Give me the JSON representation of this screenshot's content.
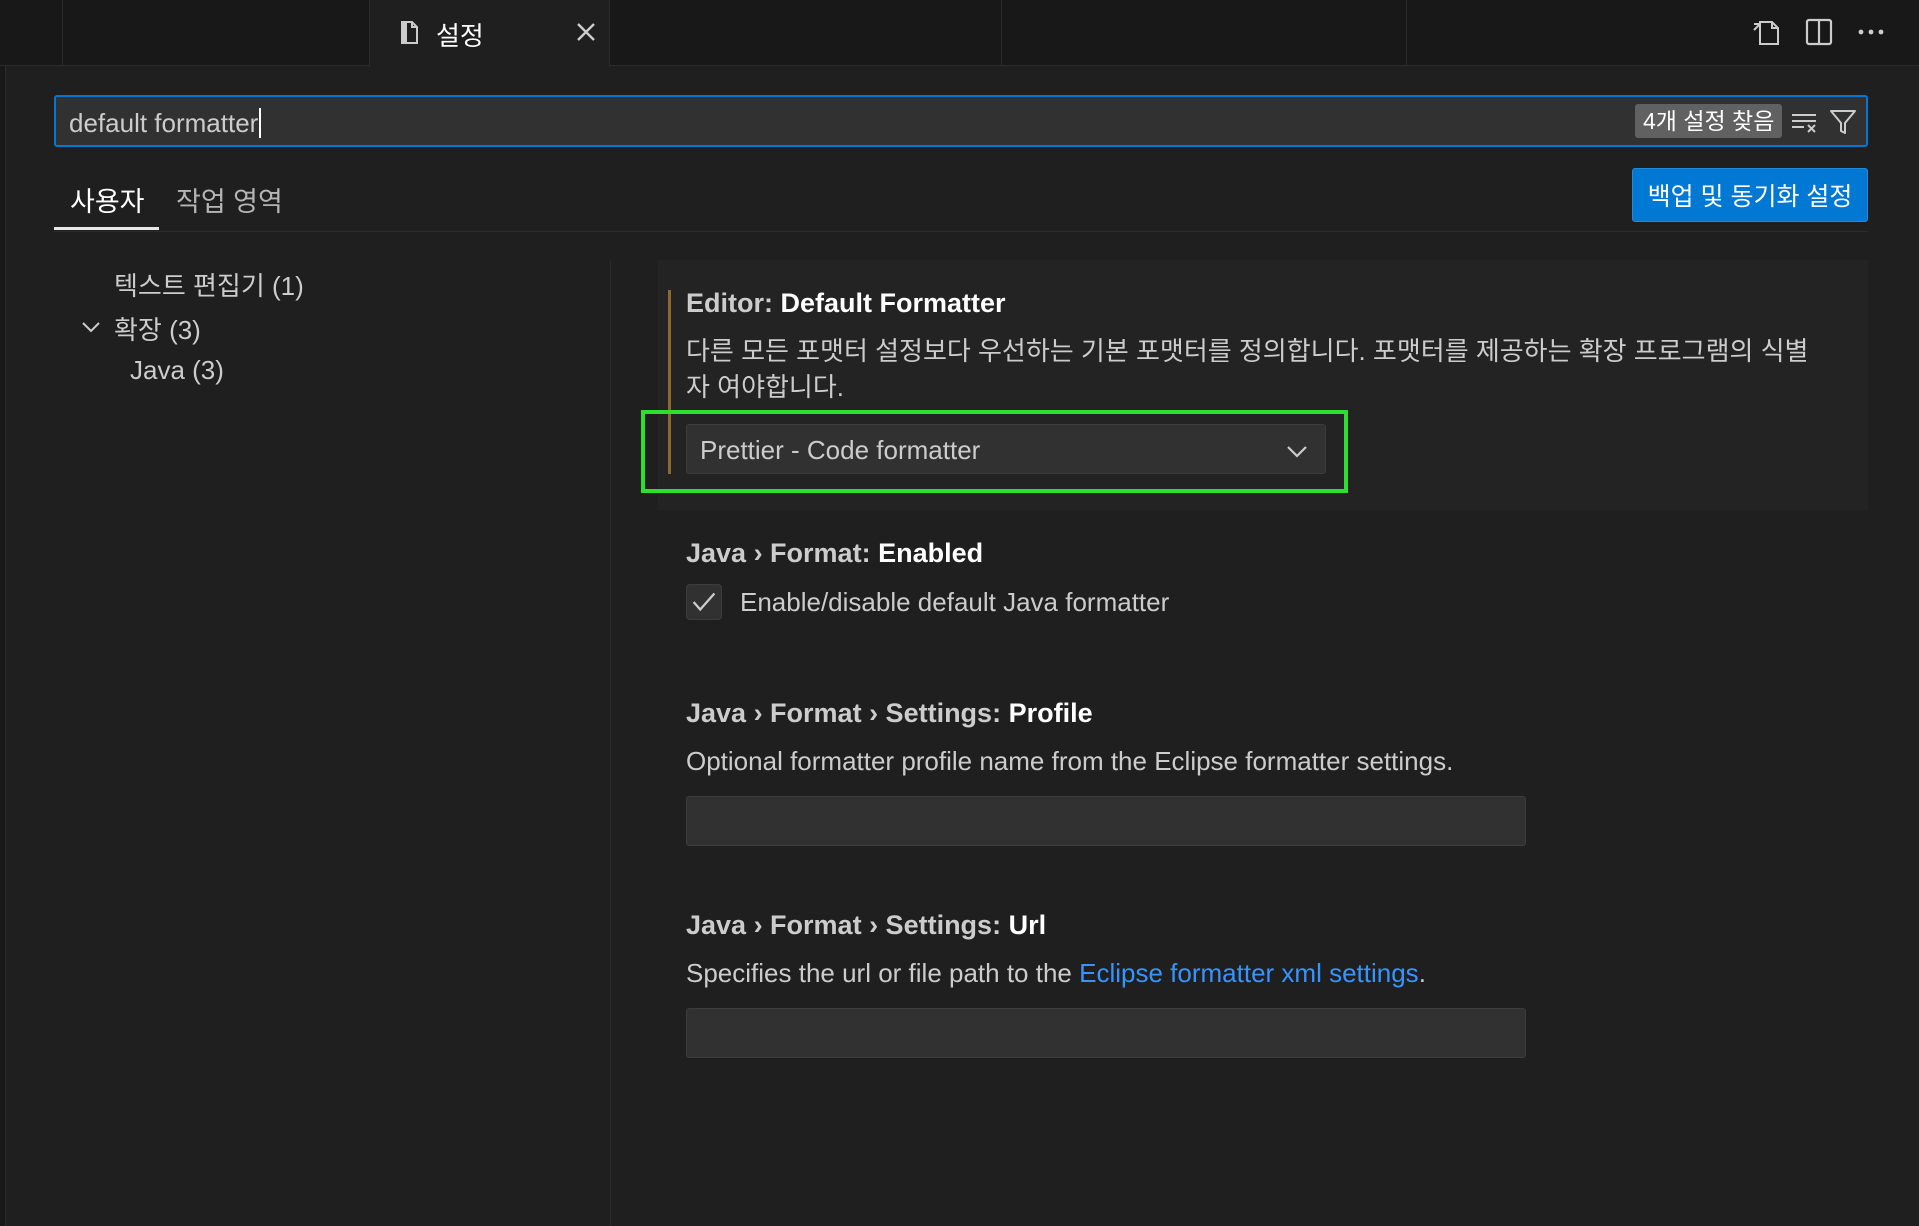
{
  "tab": {
    "title": "설정"
  },
  "search": {
    "value": "default formatter",
    "count": "4개 설정 찾음"
  },
  "scope_tabs": {
    "user": "사용자",
    "workspace": "작업 영역"
  },
  "sync_button": "백업 및 동기화 설정",
  "toc": {
    "text_editor": "텍스트 편집기 (1)",
    "extensions": "확장 (3)",
    "java": "Java (3)"
  },
  "settings": [
    {
      "category": "Editor: ",
      "key": "Default Formatter",
      "description_line1": "다른 모든 포맷터 설정보다 우선하는 기본 포맷터를 정의합니다. 포맷터를 제공하는 확장 프로그램의 식별",
      "description_line2": "자 여야합니다.",
      "value": "Prettier - Code formatter"
    },
    {
      "category": "Java › Format: ",
      "key": "Enabled",
      "checkbox_label": "Enable/disable default Java formatter",
      "checked": true
    },
    {
      "category": "Java › Format › Settings: ",
      "key": "Profile",
      "description": "Optional formatter profile name from the Eclipse formatter settings.",
      "value": ""
    },
    {
      "category": "Java › Format › Settings: ",
      "key": "Url",
      "description_prefix": "Specifies the url or file path to the ",
      "description_link": "Eclipse formatter xml settings",
      "description_suffix": ".",
      "value": ""
    }
  ],
  "colors": {
    "accent": "#0078d4",
    "highlight": "#2ee02e",
    "link": "#3794ff",
    "background": "#1f1f1f"
  },
  "icons": [
    "file-icon",
    "close-icon",
    "open-settings-json-icon",
    "split-editor-icon",
    "more-actions-icon",
    "clear-filter-icon",
    "filter-icon",
    "chevron-down-icon",
    "check-icon"
  ]
}
